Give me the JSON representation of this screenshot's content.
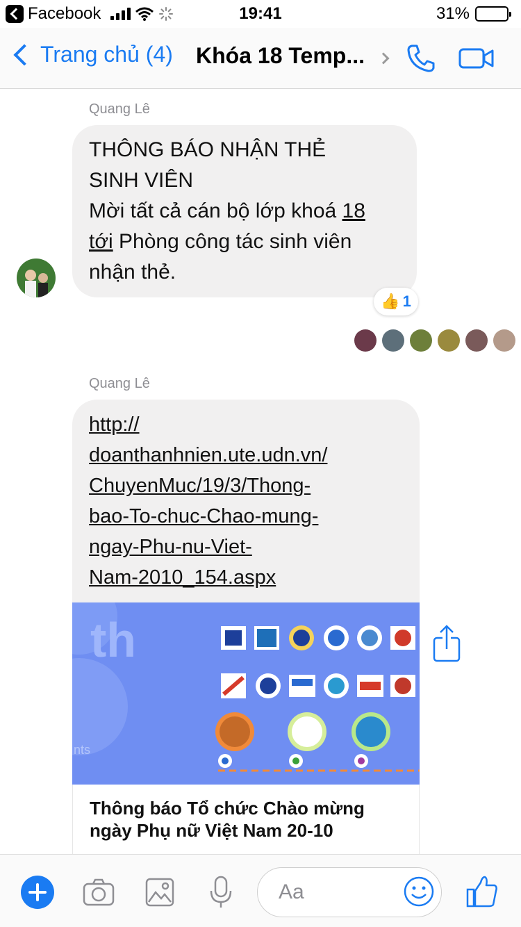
{
  "status_bar": {
    "back_app": "Facebook",
    "time": "19:41",
    "battery": "31%",
    "battery_level": 0.31
  },
  "nav": {
    "back_label": "Trang chủ (4)",
    "title": "Khóa 18 Temp..."
  },
  "messages": [
    {
      "sender": "Quang Lê",
      "lines": [
        [
          "THÔNG BÁO NHẬN THẺ"
        ],
        [
          "SINH VIÊN"
        ],
        [
          "Mời tất cả cán bộ lớp khoá ",
          "18"
        ],
        [
          "tới",
          " Phòng công tác sinh viên"
        ],
        [
          "nhận thẻ."
        ]
      ],
      "reaction_icon": "thumbs-up-emoji",
      "reaction_count": "1"
    },
    {
      "sender": "Quang Lê",
      "link_lines": [
        "http://",
        "doanthanhnien.ute.udn.vn/",
        "ChuyenMuc/19/3/Thong-",
        "bao-To-chuc-Chao-mung-",
        "ngay-Phu-nu-Viet-",
        "Nam-2010_154.aspx"
      ],
      "preview_big_text": "th",
      "preview_small_text": "nts",
      "preview_title": "Thông báo Tổ chức Chào mừng ngày Phụ nữ Việt Nam 20-10"
    }
  ],
  "composer": {
    "placeholder": "Aa"
  },
  "colors": {
    "accent": "#1a7bf2",
    "bubble": "#f1f0f0",
    "preview_bg": "#6f8ef2"
  }
}
